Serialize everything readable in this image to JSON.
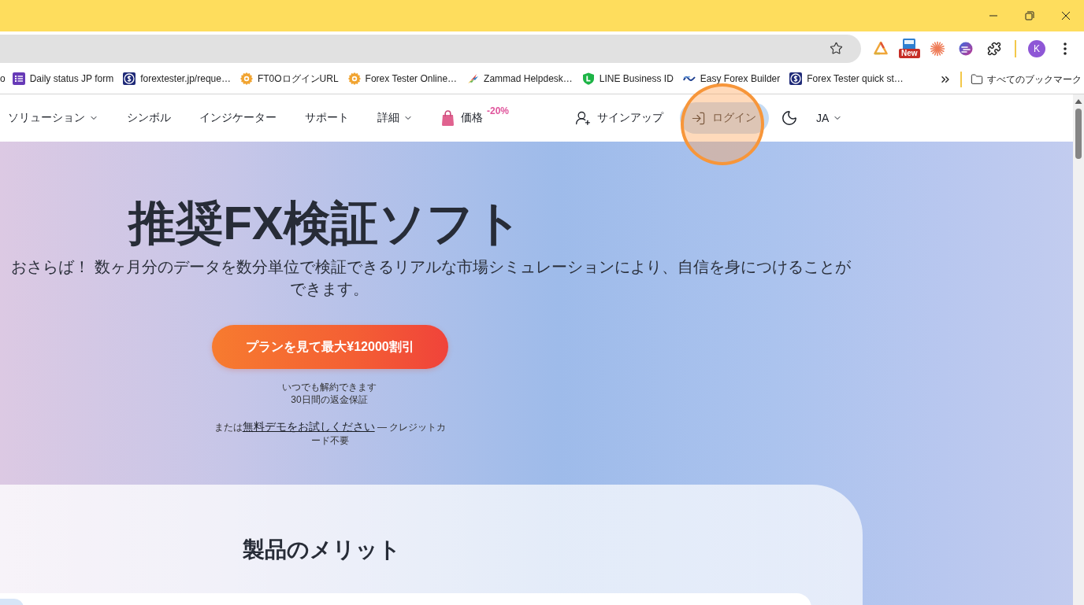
{
  "toolbar": {
    "extension_badge": "New",
    "profile_initial": "K"
  },
  "bookmarks": {
    "items": [
      {
        "kind": "text",
        "label": "o"
      },
      {
        "kind": "form",
        "label": "Daily status JP form"
      },
      {
        "kind": "dollar",
        "label": "forextester.jp/reque…"
      },
      {
        "kind": "gear",
        "label": "FT0OログインURL"
      },
      {
        "kind": "gear",
        "label": "Forex Tester Online…"
      },
      {
        "kind": "bird",
        "label": "Zammad Helpdesk…"
      },
      {
        "kind": "shield",
        "label": "LINE Business ID"
      },
      {
        "kind": "ribbon",
        "label": "Easy Forex Builder"
      },
      {
        "kind": "dollar",
        "label": "Forex Tester quick st…"
      }
    ],
    "all_bookmarks": "すべてのブックマーク"
  },
  "nav": {
    "items": [
      {
        "kind": "menu",
        "label": "ソリューション"
      },
      {
        "kind": "link",
        "label": "シンボル"
      },
      {
        "kind": "link",
        "label": "インジケーター"
      },
      {
        "kind": "link",
        "label": "サポート"
      },
      {
        "kind": "menu",
        "label": "詳細"
      },
      {
        "kind": "price",
        "label": "価格",
        "badge": "-20%"
      }
    ],
    "signup": "サインアップ",
    "login": "ログイン",
    "language": "JA"
  },
  "hero": {
    "title": "推奨FX検証ソフト",
    "subtitle": "おさらば！ 数ヶ月分のデータを数分単位で検証できるリアルな市場シミュレーションにより、自信を身につけることができます。",
    "cta": "プランを見て最大¥12000割引",
    "notes": [
      "いつでも解約できます",
      "30日間の返金保証"
    ],
    "demo_note": {
      "before": "または",
      "link": "無料デモをお試しください",
      "after": " — クレジットカード不要"
    }
  },
  "benefits": {
    "title": "製品のメリット"
  }
}
